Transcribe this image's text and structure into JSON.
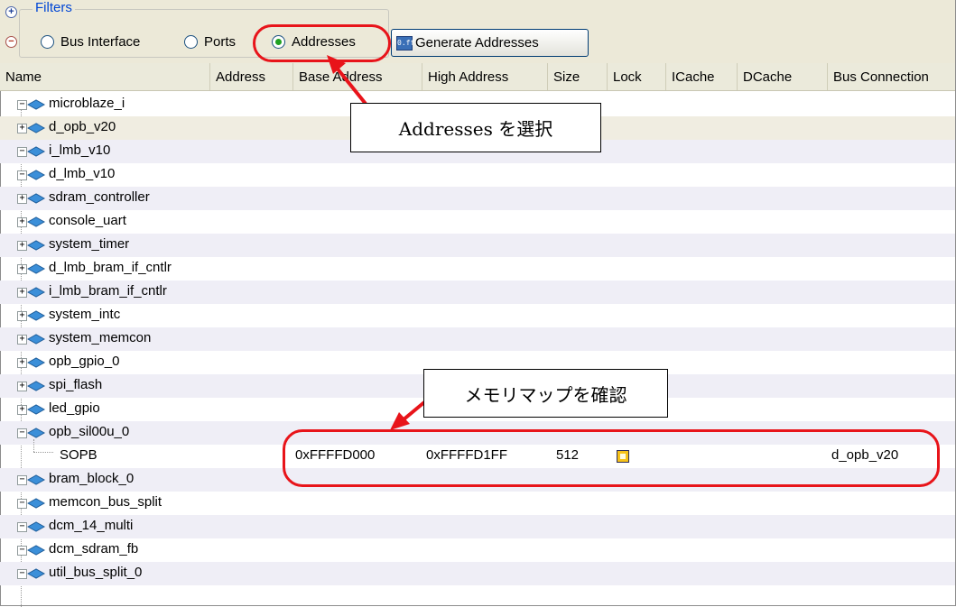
{
  "filters": {
    "legend": "Filters",
    "expand_symbols": [
      "+",
      "−"
    ],
    "radios": [
      {
        "label": "Bus Interface",
        "checked": false
      },
      {
        "label": "Ports",
        "checked": false
      },
      {
        "label": "Addresses",
        "checked": true
      }
    ],
    "generate_button": "Generate Addresses",
    "generate_icon_text": "0.ff"
  },
  "columns": [
    "Name",
    "Address",
    "Base Address",
    "High Address",
    "Size",
    "Lock",
    "ICache",
    "DCache",
    "Bus Connection"
  ],
  "rows": [
    {
      "name": "microblaze_i",
      "expander": "−"
    },
    {
      "name": "d_opb_v20",
      "expander": "+"
    },
    {
      "name": "i_lmb_v10",
      "expander": "−"
    },
    {
      "name": "d_lmb_v10",
      "expander": "−"
    },
    {
      "name": "sdram_controller",
      "expander": "+"
    },
    {
      "name": "console_uart",
      "expander": "+"
    },
    {
      "name": "system_timer",
      "expander": "+"
    },
    {
      "name": "d_lmb_bram_if_cntlr",
      "expander": "+"
    },
    {
      "name": "i_lmb_bram_if_cntlr",
      "expander": "+"
    },
    {
      "name": "system_intc",
      "expander": "+"
    },
    {
      "name": "system_memcon",
      "expander": "+"
    },
    {
      "name": "opb_gpio_0",
      "expander": "+"
    },
    {
      "name": "spi_flash",
      "expander": "+"
    },
    {
      "name": "led_gpio",
      "expander": "+"
    },
    {
      "name": "opb_sil00u_0",
      "expander": "−"
    },
    {
      "name": "bram_block_0",
      "expander": "−"
    },
    {
      "name": "memcon_bus_split",
      "expander": "−"
    },
    {
      "name": "dcm_14_multi",
      "expander": "−"
    },
    {
      "name": "dcm_sdram_fb",
      "expander": "−"
    },
    {
      "name": "util_bus_split_0",
      "expander": "−"
    }
  ],
  "child_row": {
    "name": "SOPB",
    "base_address": "0xFFFFD000",
    "high_address": "0xFFFFD1FF",
    "size": "512",
    "bus_connection": "d_opb_v20"
  },
  "annotations": {
    "select_callout": "Addresses を選択",
    "confirm_callout": "メモリマップを確認"
  },
  "colors": {
    "annotation_red": "#e8141a",
    "component_bead": "#3b8fd9",
    "filters_text": "#0046d5"
  }
}
